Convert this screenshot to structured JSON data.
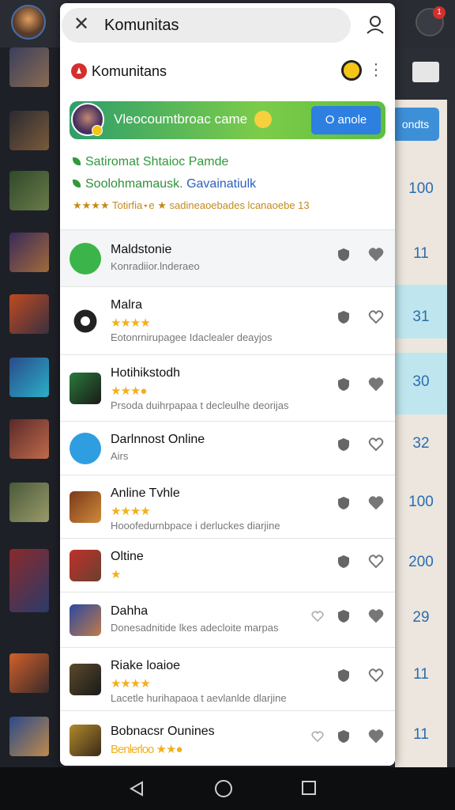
{
  "search": {
    "value": "Komunitas"
  },
  "header": {
    "brand_name": "Komunitans"
  },
  "welcome": {
    "text": "Vleocoumtbroac came",
    "button_label": "O anole"
  },
  "info": {
    "line1": "Satiromat Shtaioc Pamde",
    "line2_part1": "Soolohmamausk.",
    "line2_part2": "Gavainatiulk",
    "line3": "★★★★ Totirfia⋆e ★ sadineaoebades lcanaoebe 13"
  },
  "games": [
    {
      "title": "Maldstonie",
      "stars": "",
      "subtitle": "Konradiior.lnderaeo",
      "row_height": 72
    },
    {
      "title": "Malra",
      "stars": "★★★★",
      "subtitle": "Eotonrnirupagee Idaclealer deayjos",
      "row_height": 86
    },
    {
      "title": "Hotihikstodh",
      "stars": "★★★●",
      "subtitle": "Prsoda duihrpapaa t decleulhe deorijas",
      "row_height": 84
    },
    {
      "title": "Darlnnost Online",
      "stars": "",
      "subtitle": "Airs",
      "row_height": 68
    },
    {
      "title": "Anline Tvhle",
      "stars": "★★★★",
      "subtitle": "Hooofedurnbpace i derluckes diarjine",
      "row_height": 80
    },
    {
      "title": "Oltine",
      "stars": "★",
      "subtitle": "",
      "row_height": 68
    },
    {
      "title": "Dahha",
      "stars": "",
      "subtitle": "Donesadnitide lkes adecloite marpas",
      "row_height": 70
    },
    {
      "title": "Riake loaioe",
      "stars": "★★★★",
      "subtitle": "Lacetle hurihapaoa t aevlanlde dlarjine",
      "row_height": 80
    },
    {
      "title": "Bobnacsr Ounines",
      "stars": "Benlerloo ★★●",
      "subtitle": "",
      "row_height": 74
    }
  ],
  "background": {
    "side_button": "ondts",
    "numbers": [
      "100",
      "11",
      "31",
      "30",
      "32",
      "100",
      "200",
      "29",
      "11",
      "11"
    ],
    "notification_count": "1"
  },
  "colors": {
    "accent_green": "#5fbf3d",
    "accent_blue": "#2d7fe0",
    "star_gold": "#f2b01e"
  }
}
